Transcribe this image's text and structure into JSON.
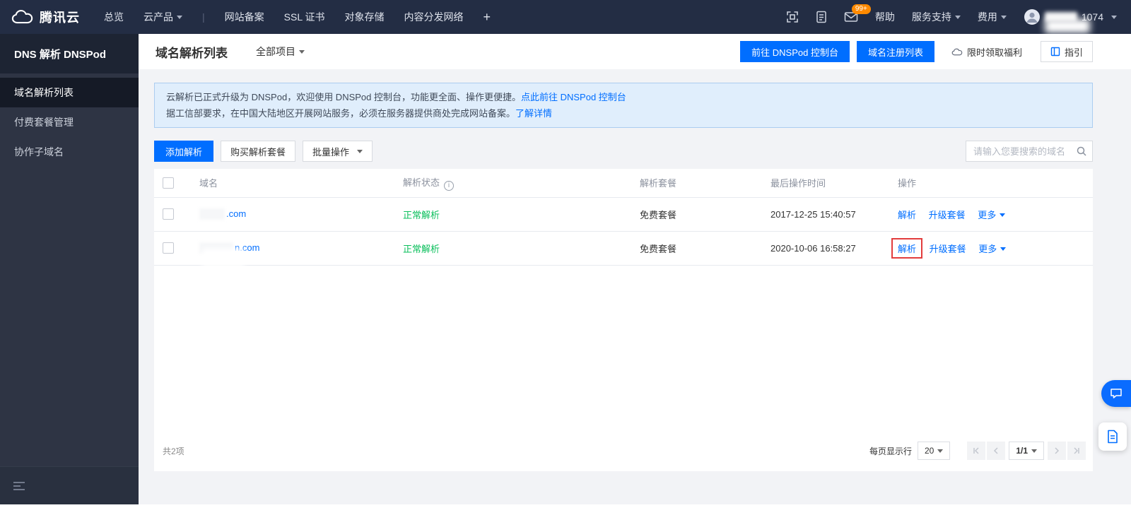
{
  "colors": {
    "accent_blue": "#006eff",
    "status_green": "#0abf5b",
    "highlight_red": "#e23d3d",
    "badge_orange": "#ff8a00",
    "banner_bg": "#e0eefc",
    "topbar_bg": "#232d44"
  },
  "topbar": {
    "brand": "腾讯云",
    "nav_overview": "总览",
    "nav_products": "云产品",
    "nav_separator": "|",
    "nav_icp": "网站备案",
    "nav_ssl": "SSL 证书",
    "nav_cos": "对象存储",
    "nav_cdn": "内容分发网络",
    "nav_plus": "+",
    "badge": "99+",
    "help": "帮助",
    "support": "服务支持",
    "billing": "费用",
    "account_suffix": "1074"
  },
  "sidebar": {
    "title": "DNS 解析 DNSPod",
    "items": [
      {
        "label": "域名解析列表"
      },
      {
        "label": "付费套餐管理"
      },
      {
        "label": "协作子域名"
      }
    ]
  },
  "page": {
    "title": "域名解析列表",
    "project_filter": "全部项目",
    "goto_dnspod": "前往 DNSPod 控制台",
    "domain_register": "域名注册列表",
    "promo": "限时领取福利",
    "guide": "指引"
  },
  "banner": {
    "line1": "云解析已正式升级为 DNSPod，欢迎使用 DNSPod 控制台，功能更全面、操作更便捷。",
    "line1_link": "点此前往 DNSPod 控制台",
    "line2": "据工信部要求，在中国大陆地区开展网站服务，必须在服务器提供商处完成网站备案。",
    "line2_link": "了解详情"
  },
  "toolbar": {
    "add": "添加解析",
    "buy": "购买解析套餐",
    "batch": "批量操作",
    "search_placeholder": "请输入您要搜索的域名"
  },
  "table": {
    "headers": {
      "domain": "域名",
      "status": "解析状态",
      "plan": "解析套餐",
      "time": "最后操作时间",
      "actions": "操作"
    },
    "rows": [
      {
        "domain_visible": ".com",
        "status": "正常解析",
        "plan": "免费套餐",
        "time": "2017-12-25 15:40:57"
      },
      {
        "domain_visible": "n.com",
        "status": "正常解析",
        "plan": "免费套餐",
        "time": "2020-10-06 16:58:27"
      }
    ],
    "actions": {
      "resolve": "解析",
      "upgrade": "升级套餐",
      "more": "更多"
    }
  },
  "footer": {
    "total": "共2项",
    "per_page_label": "每页显示行",
    "per_page": "20",
    "page_indicator": "1/1"
  },
  "icons": {
    "info": "i"
  }
}
